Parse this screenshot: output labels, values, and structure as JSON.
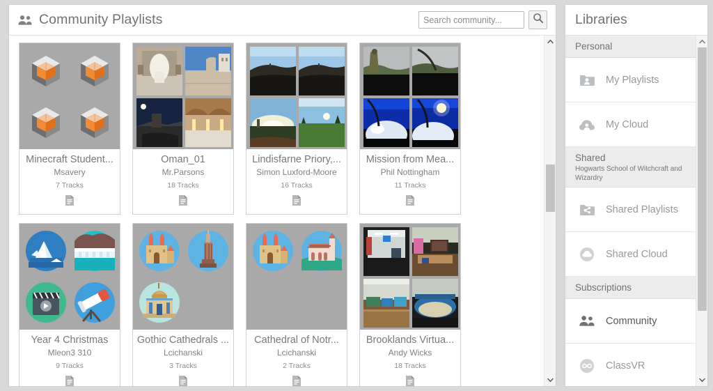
{
  "header": {
    "title": "Community Playlists",
    "icon": "people-icon",
    "search": {
      "placeholder": "Search community...",
      "value": "",
      "button_icon": "search-icon"
    }
  },
  "sidebar": {
    "title": "Libraries",
    "scrollbar": {
      "up_icon": "chevron-up-icon",
      "down_icon": "chevron-down-icon"
    },
    "groups": [
      {
        "label": "Personal",
        "sublabel": "",
        "items": [
          {
            "label": "My Playlists",
            "icon": "folder-user-icon",
            "active": false
          },
          {
            "label": "My Cloud",
            "icon": "cloud-user-icon",
            "active": false
          }
        ]
      },
      {
        "label": "Shared",
        "sublabel": "Hogwarts School of Witchcraft and Wizardry",
        "items": [
          {
            "label": "Shared Playlists",
            "icon": "folder-share-icon",
            "active": false
          },
          {
            "label": "Shared Cloud",
            "icon": "cloud-share-icon",
            "active": false
          }
        ]
      },
      {
        "label": "Subscriptions",
        "sublabel": "",
        "items": [
          {
            "label": "Community",
            "icon": "people-icon",
            "active": true
          },
          {
            "label": "ClassVR",
            "icon": "infinity-icon",
            "active": false
          }
        ]
      }
    ]
  },
  "main": {
    "scrollbar": {
      "up_icon": "chevron-up-icon",
      "down_icon": "chevron-down-icon"
    },
    "cards": [
      {
        "title": "Minecraft Student...",
        "author": "Msavery",
        "tracks": "7 Tracks",
        "doc_icon": "document-icon",
        "thumb_kind": "cube",
        "thumb_count": 4
      },
      {
        "title": "Oman_01",
        "author": "Mr.Parsons",
        "tracks": "18 Tracks",
        "doc_icon": "document-icon",
        "thumb_kind": "photo-oman",
        "thumb_count": 4
      },
      {
        "title": "Lindisfarne Priory,...",
        "author": "Simon Luxford-Moore",
        "tracks": "16 Tracks",
        "doc_icon": "document-icon",
        "thumb_kind": "photo-lindisfarne",
        "thumb_count": 4
      },
      {
        "title": "Mission from Mea...",
        "author": "Phil Nottingham",
        "tracks": "11 Tracks",
        "doc_icon": "document-icon",
        "thumb_kind": "photo-mission",
        "thumb_count": 4
      },
      {
        "title": "Year 4 Christmas",
        "author": "Mleon3 310",
        "tracks": "9 Tracks",
        "doc_icon": "document-icon",
        "thumb_kind": "flat-year4",
        "thumb_count": 4
      },
      {
        "title": "Gothic Cathedrals ...",
        "author": "Lcichanski",
        "tracks": "3 Tracks",
        "doc_icon": "document-icon",
        "thumb_kind": "flat-gothic",
        "thumb_count": 3
      },
      {
        "title": "Cathedral of Notr...",
        "author": "Lcichanski",
        "tracks": "2 Tracks",
        "doc_icon": "document-icon",
        "thumb_kind": "flat-notre",
        "thumb_count": 2
      },
      {
        "title": "Brooklands Virtua...",
        "author": "Andy Wicks",
        "tracks": "18 Tracks",
        "doc_icon": "document-icon",
        "thumb_kind": "photo-brooklands",
        "thumb_count": 4
      }
    ]
  },
  "colors": {
    "page_bg": "#d9d9d9",
    "panel_bg": "#ffffff",
    "thumb_bg": "#a9a9a9",
    "text_muted": "#96999d",
    "text_title": "#6f7276",
    "accent_orange": "#e87722",
    "group_bg": "#ececec"
  }
}
